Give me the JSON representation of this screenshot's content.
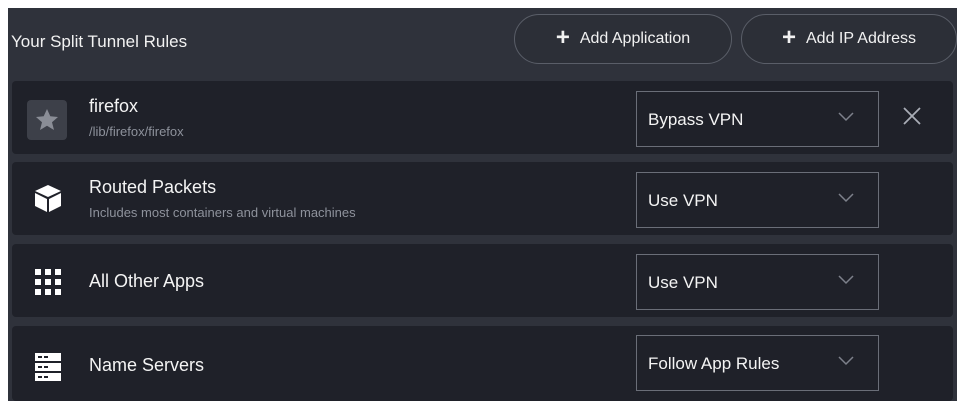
{
  "header": {
    "title": "Your Split Tunnel Rules",
    "add_application_label": "Add Application",
    "add_ip_label": "Add IP Address",
    "plus_glyph": "+"
  },
  "rules": [
    {
      "name": "firefox",
      "subtitle": "/lib/firefox/firefox",
      "icon": "app-star-icon",
      "mode": "Bypass VPN",
      "removable": true
    },
    {
      "name": "Routed Packets",
      "subtitle": "Includes most containers and virtual machines",
      "icon": "cube-icon",
      "mode": "Use VPN",
      "removable": false
    },
    {
      "name": "All Other Apps",
      "subtitle": "",
      "icon": "app-grid-icon",
      "mode": "Use VPN",
      "removable": false
    },
    {
      "name": "Name Servers",
      "subtitle": "",
      "icon": "server-icon",
      "mode": "Follow App Rules",
      "removable": false
    }
  ],
  "colors": {
    "background": "#2f323b",
    "row": "#1f2129",
    "text": "#f4f4f4",
    "muted": "#8e929c",
    "border": "#6a6e78"
  }
}
